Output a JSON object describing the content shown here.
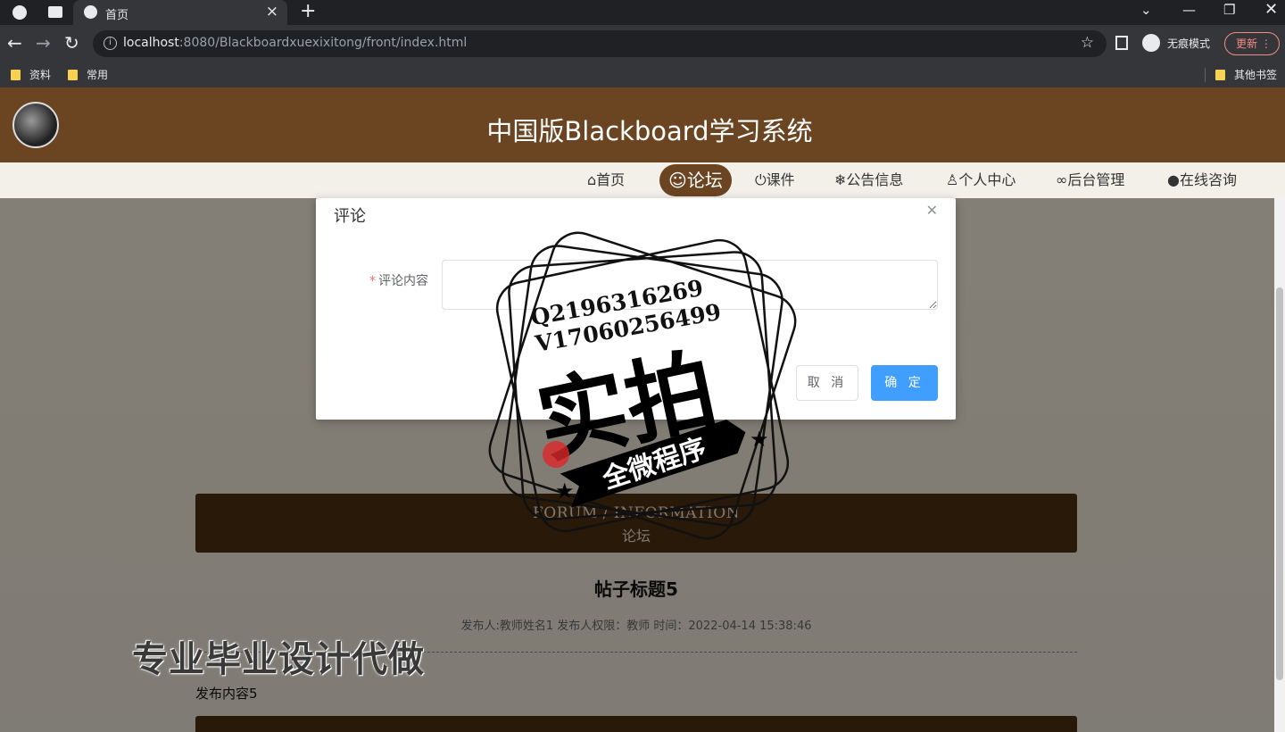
{
  "browser": {
    "tab_title": "首页",
    "url_host": "localhost",
    "url_rest": ":8080/Blackboardxuexixitong/front/index.html",
    "incognito_label": "无痕模式",
    "update_label": "更新",
    "bookmarks": [
      "资料",
      "常用"
    ],
    "other_bookmarks": "其他书签"
  },
  "site": {
    "title": "中国版Blackboard学习系统",
    "nav": [
      {
        "label": "首页",
        "icon": "home-icon",
        "glyph": "⌂"
      },
      {
        "label": "论坛",
        "icon": "forum-icon",
        "glyph": "☺"
      },
      {
        "label": "课件",
        "icon": "power-icon",
        "glyph": "⏻"
      },
      {
        "label": "公告信息",
        "icon": "snowflake-icon",
        "glyph": "❄"
      },
      {
        "label": "个人中心",
        "icon": "user-icon",
        "glyph": "♙"
      },
      {
        "label": "后台管理",
        "icon": "link-icon",
        "glyph": "🔗"
      },
      {
        "label": "在线咨询",
        "icon": "chat-icon",
        "glyph": "●"
      }
    ],
    "active_nav": "论坛"
  },
  "forum": {
    "banner_en": "FORUM / INFORMATION",
    "banner_cn": "论坛",
    "post_title": "帖子标题5",
    "post_meta": "发布人:教师姓名1  发布人权限：教师  时间：2022-04-14 15:38:46",
    "post_content": "发布内容5"
  },
  "dialog": {
    "title": "评论",
    "field_label": "评论内容",
    "field_value": "",
    "cancel_label": "取 消",
    "ok_label": "确 定"
  },
  "watermark": {
    "qq": "Q2196316269",
    "wechat": "V17060256499",
    "big": "实拍",
    "ribbon": "全微程序",
    "side_text": "专业毕业设计代做"
  },
  "colors": {
    "header_brown": "#6b4422",
    "banner_brown": "#4b2e12",
    "primary_blue": "#409eff"
  }
}
